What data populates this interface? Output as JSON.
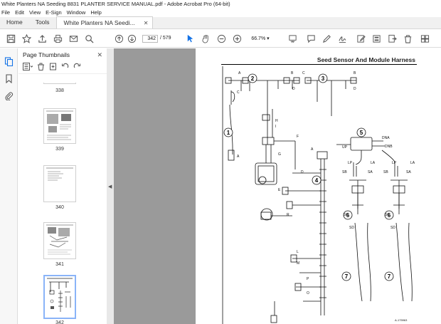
{
  "window": {
    "title": "White Planters NA Seeding  8831 PLANTER SERVICE MANUAL.pdf - Adobe Acrobat Pro (64-bit)"
  },
  "menu": [
    "File",
    "Edit",
    "View",
    "E-Sign",
    "Window",
    "Help"
  ],
  "tabs": {
    "home": "Home",
    "tools": "Tools",
    "document": "White Planters NA Seedi..."
  },
  "toolbar": {
    "current_page": "342",
    "page_count": "/ 579",
    "zoom": "66.7%"
  },
  "panel": {
    "title": "Page Thumbnails",
    "thumbnails": [
      {
        "label": "338"
      },
      {
        "label": "339"
      },
      {
        "label": "340"
      },
      {
        "label": "341"
      },
      {
        "label": "342",
        "selected": true
      }
    ]
  },
  "document": {
    "header": "Seed Sensor And Module Harness",
    "callouts": [
      "1",
      "2",
      "3",
      "4",
      "5",
      "6",
      "6",
      "7",
      "7"
    ],
    "connector_letters": [
      "A",
      "B",
      "C",
      "D",
      "E",
      "F",
      "G",
      "H",
      "I",
      "J",
      "K",
      "L",
      "M",
      "N",
      "O",
      "P",
      "Q",
      "R",
      "S",
      "T"
    ],
    "wire_labels": [
      "SB",
      "SA",
      "SC",
      "SD",
      "LP",
      "LA",
      "DNA",
      "DNB",
      "UP",
      "SCH"
    ],
    "figure_id": "A-175963"
  }
}
